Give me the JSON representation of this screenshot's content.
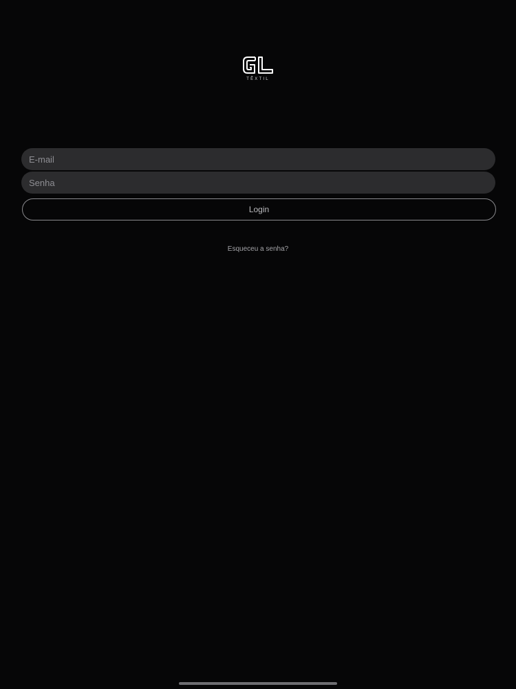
{
  "brand": {
    "logo_letters": "GL",
    "logo_subtitle": "TÊXTIL"
  },
  "form": {
    "email_placeholder": "E-mail",
    "email_value": "",
    "password_placeholder": "Senha",
    "password_value": "",
    "login_label": "Login",
    "forgot_label": "Esqueceu a senha?"
  },
  "colors": {
    "background": "#060607",
    "field_background": "#2c2c2e",
    "button_border": "#8a8a8e"
  }
}
